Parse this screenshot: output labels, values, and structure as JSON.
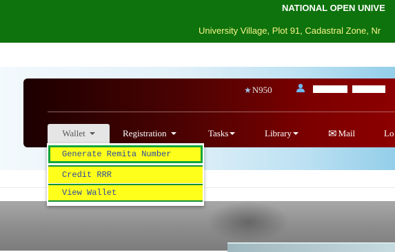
{
  "header": {
    "title": "NATIONAL OPEN UNIVE",
    "address": "University Village, Plot 91, Cadastral Zone, Nr"
  },
  "panel": {
    "wallet_balance": "N950",
    "balance_icon": "money-icon",
    "user_icon": "user-icon"
  },
  "nav": {
    "items": [
      {
        "label": "Wallet",
        "active": true
      },
      {
        "label": "Registration"
      },
      {
        "label": "Tasks"
      },
      {
        "label": "Library"
      },
      {
        "label": "Mail",
        "icon": "envelope-icon"
      },
      {
        "label": "Lo"
      }
    ]
  },
  "wallet_menu": {
    "items": [
      {
        "label": "Generate Remita Number",
        "selected": true
      },
      {
        "label": "Credit RRR"
      },
      {
        "label": "View Wallet"
      }
    ]
  },
  "colors": {
    "header_green": "#0e730c",
    "address_yellow": "#f7f48a",
    "panel_dark_red": "#7d0000",
    "menu_highlight_yellow": "#ffff1c",
    "menu_border_green": "#10a63a",
    "menu_text_blue": "#2c4a9b"
  }
}
